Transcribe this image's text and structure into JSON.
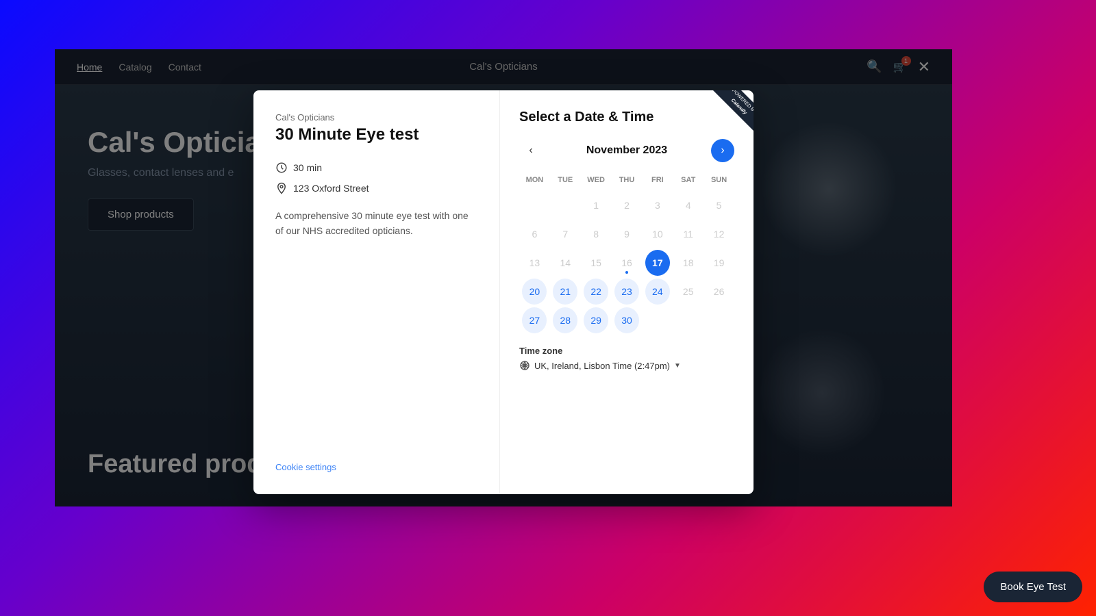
{
  "nav": {
    "links": [
      {
        "label": "Home",
        "active": true
      },
      {
        "label": "Catalog",
        "active": false
      },
      {
        "label": "Contact",
        "active": false
      }
    ],
    "title": "Cal's Opticians",
    "cart_count": "1"
  },
  "hero": {
    "title": "Cal's Opticia",
    "subtitle": "Glasses, contact lenses and e",
    "shop_btn": "Shop products",
    "featured": "Featured prod"
  },
  "modal": {
    "brand": "Cal's Opticians",
    "title": "30 Minute Eye test",
    "duration": "30 min",
    "address": "123 Oxford Street",
    "description": "A comprehensive 30 minute eye test with one of our NHS accredited opticians.",
    "cookie_settings": "Cookie settings",
    "date_time_title": "Select a Date & Time",
    "month": "November 2023",
    "day_labels": [
      "MON",
      "TUE",
      "WED",
      "THU",
      "FRI",
      "SAT",
      "SUN"
    ],
    "timezone_label": "Time zone",
    "timezone_value": "UK, Ireland, Lisbon Time (2:47pm)",
    "powered_by": "POWERED BY",
    "calendly": "Calendly",
    "calendar": {
      "rows": [
        [
          null,
          null,
          null,
          "1",
          "2",
          "3",
          "4",
          "5"
        ],
        [
          "6",
          "7",
          "8",
          "9",
          "10",
          "11",
          "12"
        ],
        [
          "13",
          "14",
          "15",
          "16",
          "17",
          "18",
          "19"
        ],
        [
          "20",
          "21",
          "22",
          "23",
          "24",
          "25",
          "26"
        ],
        [
          "27",
          "28",
          "29",
          "30",
          null,
          null,
          null
        ]
      ]
    }
  },
  "book_btn": "Book Eye Test"
}
